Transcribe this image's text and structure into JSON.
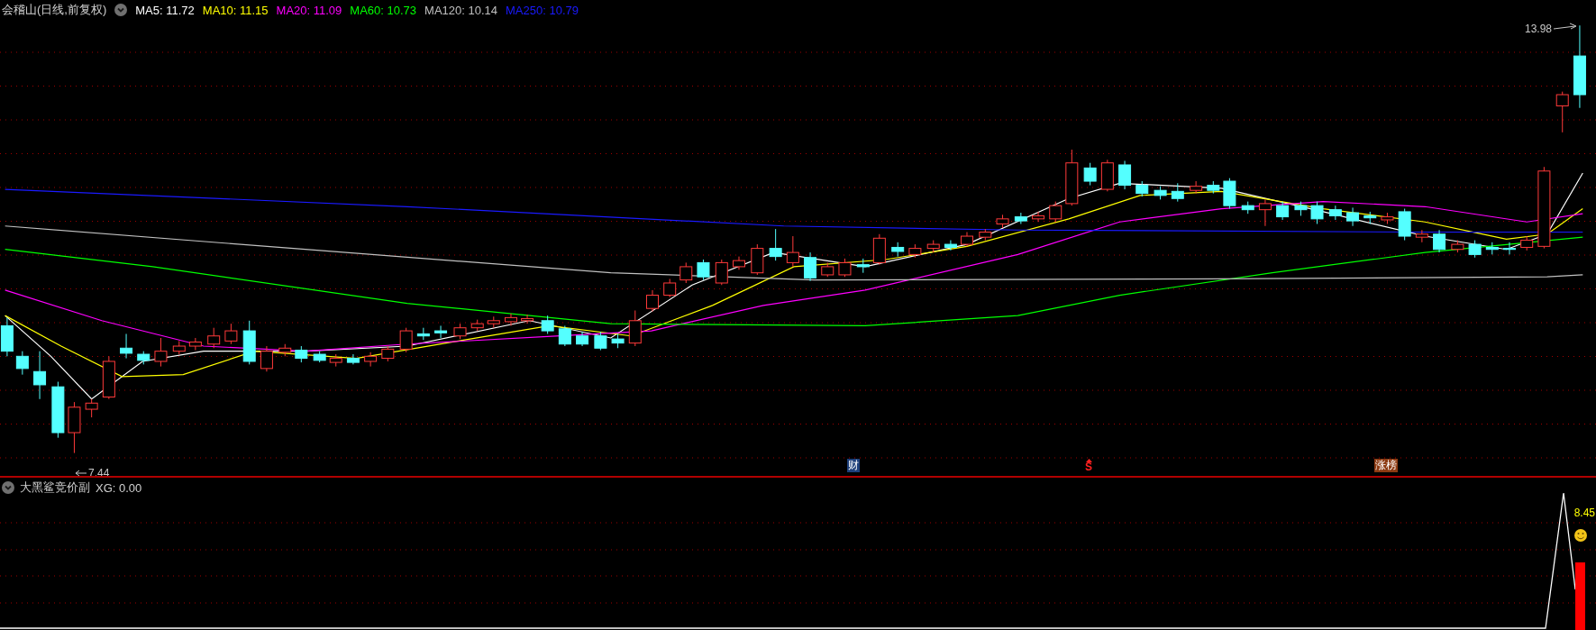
{
  "header": {
    "title": "会稽山(日线,前复权)",
    "moving_averages": [
      {
        "label": "MA5: 11.72",
        "color": "#ffffff"
      },
      {
        "label": "MA10: 11.15",
        "color": "#ffff00"
      },
      {
        "label": "MA20: 11.09",
        "color": "#ff00ff"
      },
      {
        "label": "MA60: 10.73",
        "color": "#00ff00"
      },
      {
        "label": "MA120: 10.14",
        "color": "#c0c0c0"
      },
      {
        "label": "MA250: 10.79",
        "color": "#1a1aff"
      }
    ]
  },
  "price_chart": {
    "high_label": "13.98",
    "low_label": "7.44",
    "markers": [
      {
        "kind": "finance",
        "text": "财"
      },
      {
        "kind": "signal",
        "text": "S"
      },
      {
        "kind": "ranking",
        "text": "涨榜"
      }
    ]
  },
  "indicator": {
    "title": "大黑鲨竞价副",
    "readout": "XG: 0.00",
    "value_label": "8.45"
  }
}
